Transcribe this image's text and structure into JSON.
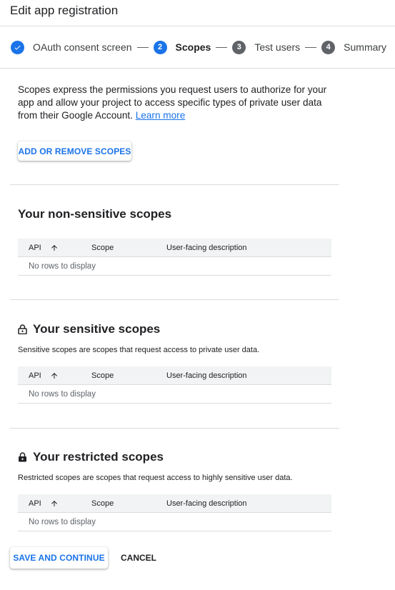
{
  "page": {
    "title": "Edit app registration"
  },
  "stepper": {
    "steps": [
      {
        "number": "",
        "label": "OAuth consent screen",
        "state": "done"
      },
      {
        "number": "2",
        "label": "Scopes",
        "state": "active"
      },
      {
        "number": "3",
        "label": "Test users",
        "state": "pending"
      },
      {
        "number": "4",
        "label": "Summary",
        "state": "pending"
      }
    ]
  },
  "intro": {
    "text": "Scopes express the permissions you request users to authorize for your app and allow your project to access specific types of private user data from their Google Account.",
    "link": "Learn more"
  },
  "buttons": {
    "add_remove": "ADD OR REMOVE SCOPES",
    "save_continue": "SAVE AND CONTINUE",
    "cancel": "CANCEL"
  },
  "table_columns": {
    "api": "API",
    "scope": "Scope",
    "description": "User-facing description"
  },
  "sections": {
    "non_sensitive": {
      "title": "Your non-sensitive scopes",
      "empty": "No rows to display"
    },
    "sensitive": {
      "title": "Your sensitive scopes",
      "description": "Sensitive scopes are scopes that request access to private user data.",
      "empty": "No rows to display"
    },
    "restricted": {
      "title": "Your restricted scopes",
      "description": "Restricted scopes are scopes that request access to highly sensitive user data.",
      "empty": "No rows to display"
    }
  },
  "colors": {
    "accent": "#1a73e8",
    "text": "#202124",
    "muted": "#5f6368",
    "divider": "#dadce0"
  }
}
